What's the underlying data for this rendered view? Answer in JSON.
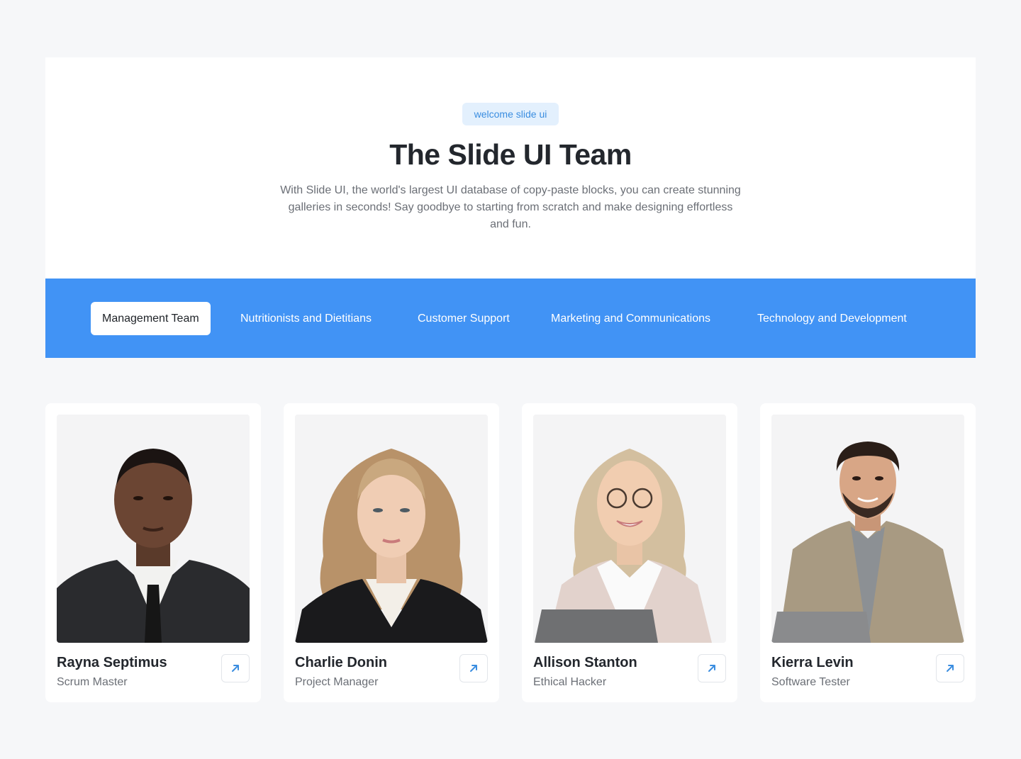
{
  "hero": {
    "badge": "welcome slide ui",
    "title": "The Slide UI Team",
    "description": "With Slide UI, the world's largest UI database of copy-paste blocks, you can create stunning galleries in seconds! Say goodbye to starting from scratch and make designing effortless and fun."
  },
  "tabs": [
    {
      "label": "Management Team",
      "active": true
    },
    {
      "label": "Nutritionists and Dietitians",
      "active": false
    },
    {
      "label": "Customer Support",
      "active": false
    },
    {
      "label": "Marketing and Communications",
      "active": false
    },
    {
      "label": "Technology and Development",
      "active": false
    }
  ],
  "members": [
    {
      "name": "Rayna Septimus",
      "role": "Scrum Master",
      "link_icon": "arrow-up-right-icon"
    },
    {
      "name": "Charlie Donin",
      "role": "Project Manager",
      "link_icon": "arrow-up-right-icon"
    },
    {
      "name": "Allison Stanton",
      "role": "Ethical Hacker",
      "link_icon": "arrow-up-right-icon"
    },
    {
      "name": "Kierra Levin",
      "role": "Software Tester",
      "link_icon": "arrow-up-right-icon"
    }
  ],
  "colors": {
    "accent": "#4193f5",
    "badge_bg": "#e3f0fd",
    "badge_text": "#3a8de0",
    "page_bg": "#f6f7f9"
  }
}
